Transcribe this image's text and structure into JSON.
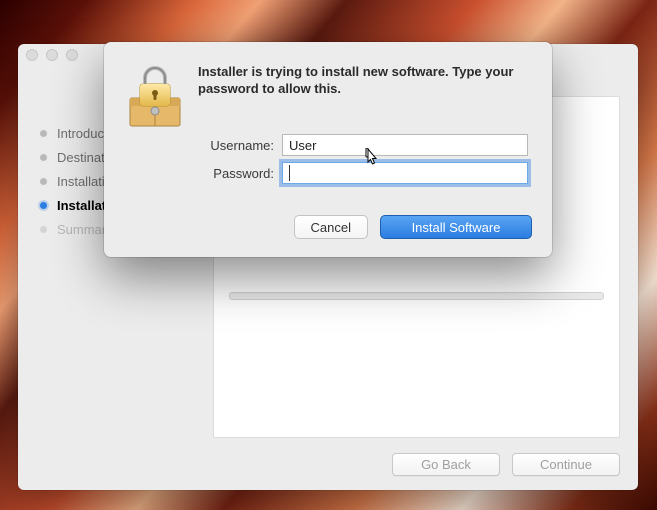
{
  "installer": {
    "steps": [
      {
        "label": "Introduction",
        "state": "done"
      },
      {
        "label": "Destination Select",
        "state": "done"
      },
      {
        "label": "Installation Type",
        "state": "done"
      },
      {
        "label": "Installation",
        "state": "current"
      },
      {
        "label": "Summary",
        "state": "future"
      }
    ],
    "go_back_label": "Go Back",
    "continue_label": "Continue"
  },
  "auth": {
    "prompt": "Installer is trying to install new software. Type your password to allow this.",
    "username_label": "Username:",
    "password_label": "Password:",
    "username_value": "User",
    "password_value": "",
    "cancel_label": "Cancel",
    "confirm_label": "Install Software",
    "icon_name": "lock-package-icon"
  }
}
